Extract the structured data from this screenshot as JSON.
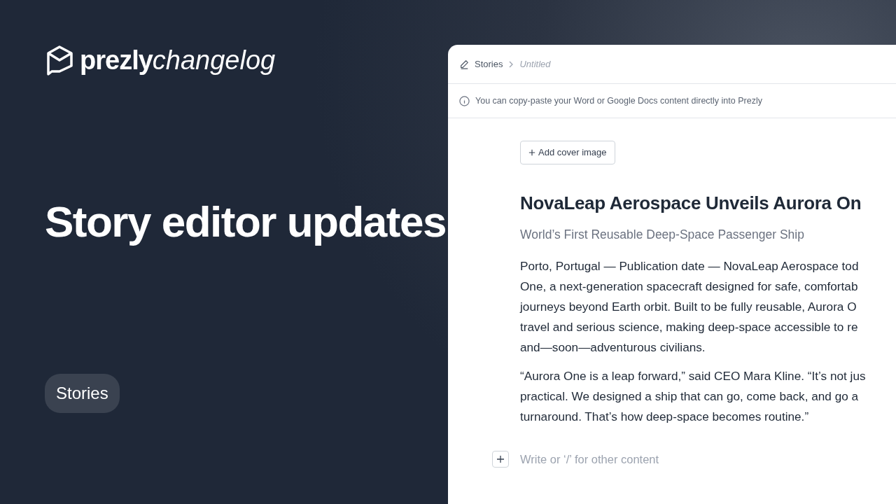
{
  "brand": {
    "name": "prezly",
    "suffix": "changelog"
  },
  "headline": "Story editor updates",
  "tag": "Stories",
  "editor": {
    "breadcrumb": [
      {
        "label": "Stories",
        "current": false
      },
      {
        "label": "Untitled",
        "current": true
      }
    ],
    "notice": "You can copy-paste your Word or Google Docs content directly into Prezly",
    "cover_button": "Add cover image",
    "title": "NovaLeap Aerospace Unveils Aurora On",
    "subtitle": "World’s First Reusable Deep-Space Passenger Ship",
    "paragraphs": [
      [
        "Porto, Portugal — Publication date — NovaLeap Aerospace tod",
        "One, a next-generation spacecraft designed for safe, comfortab",
        "journeys beyond Earth orbit. Built to be fully reusable, Aurora O",
        "travel and serious science, making deep-space accessible to re",
        "and—soon—adventurous civilians."
      ],
      [
        "“Aurora One is a leap forward,” said CEO Mara Kline. “It’s not jus",
        "practical. We designed a ship that can go, come back, and go a",
        "turnaround. That’s how deep-space becomes routine.”"
      ]
    ],
    "new_block": {
      "placeholder": "Write or ‘/’ for other content"
    }
  }
}
